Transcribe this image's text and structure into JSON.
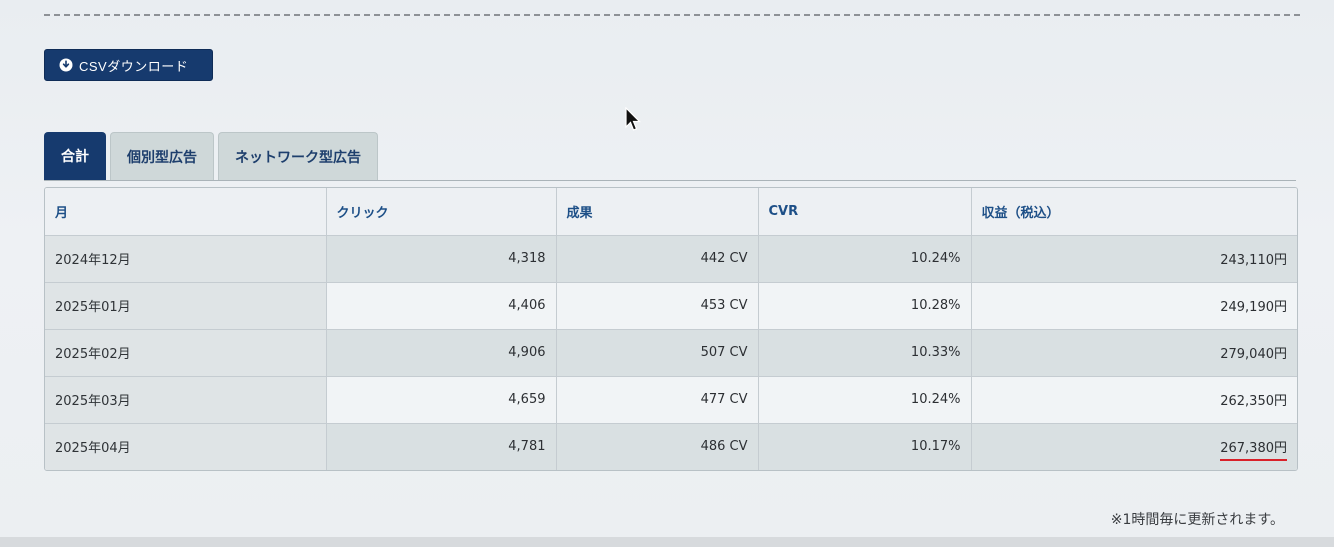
{
  "toolbar": {
    "csv_button_label": "CSVダウンロード"
  },
  "tabs": [
    {
      "label": "合計",
      "active": true
    },
    {
      "label": "個別型広告",
      "active": false
    },
    {
      "label": "ネットワーク型広告",
      "active": false
    }
  ],
  "table": {
    "headers": [
      "月",
      "クリック",
      "成果",
      "CVR",
      "収益（税込）"
    ],
    "rows": [
      {
        "month": "2024年12月",
        "clicks": "4,318",
        "conversions": "442 CV",
        "cvr": "10.24%",
        "revenue": "243,110円"
      },
      {
        "month": "2025年01月",
        "clicks": "4,406",
        "conversions": "453 CV",
        "cvr": "10.28%",
        "revenue": "249,190円"
      },
      {
        "month": "2025年02月",
        "clicks": "4,906",
        "conversions": "507 CV",
        "cvr": "10.33%",
        "revenue": "279,040円"
      },
      {
        "month": "2025年03月",
        "clicks": "4,659",
        "conversions": "477 CV",
        "cvr": "10.24%",
        "revenue": "262,350円"
      },
      {
        "month": "2025年04月",
        "clicks": "4,781",
        "conversions": "486 CV",
        "cvr": "10.17%",
        "revenue": "267,380円"
      }
    ]
  },
  "footnote": "※1時間毎に更新されます。",
  "colors": {
    "primary": "#163a6e",
    "header_text": "#1d4f87",
    "highlight_underline": "#d9212a"
  },
  "icons": {
    "csv_button_icon": "download-circle-icon",
    "cursor": "mouse-pointer-icon"
  }
}
